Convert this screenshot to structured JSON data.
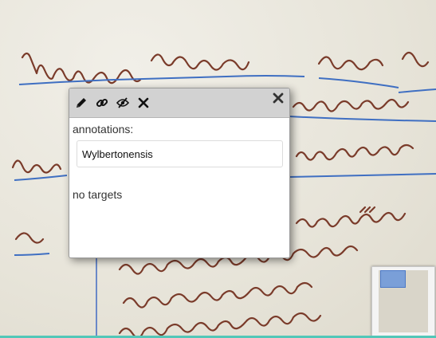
{
  "popup": {
    "toolbar": {
      "edit": "pencil-icon",
      "link": "link-icon",
      "hide": "eye-slash-icon",
      "delete": "x-icon",
      "close": "close-icon"
    },
    "annotations_label": "annotations:",
    "annotation_text": "Wylbertonensis",
    "targets_text": "no targets"
  },
  "colors": {
    "accent_blue": "#3f6fc2",
    "ink": "#7a3b2a",
    "header_bg": "#d2d2d2",
    "bottom_bar": "#52c7b8"
  }
}
